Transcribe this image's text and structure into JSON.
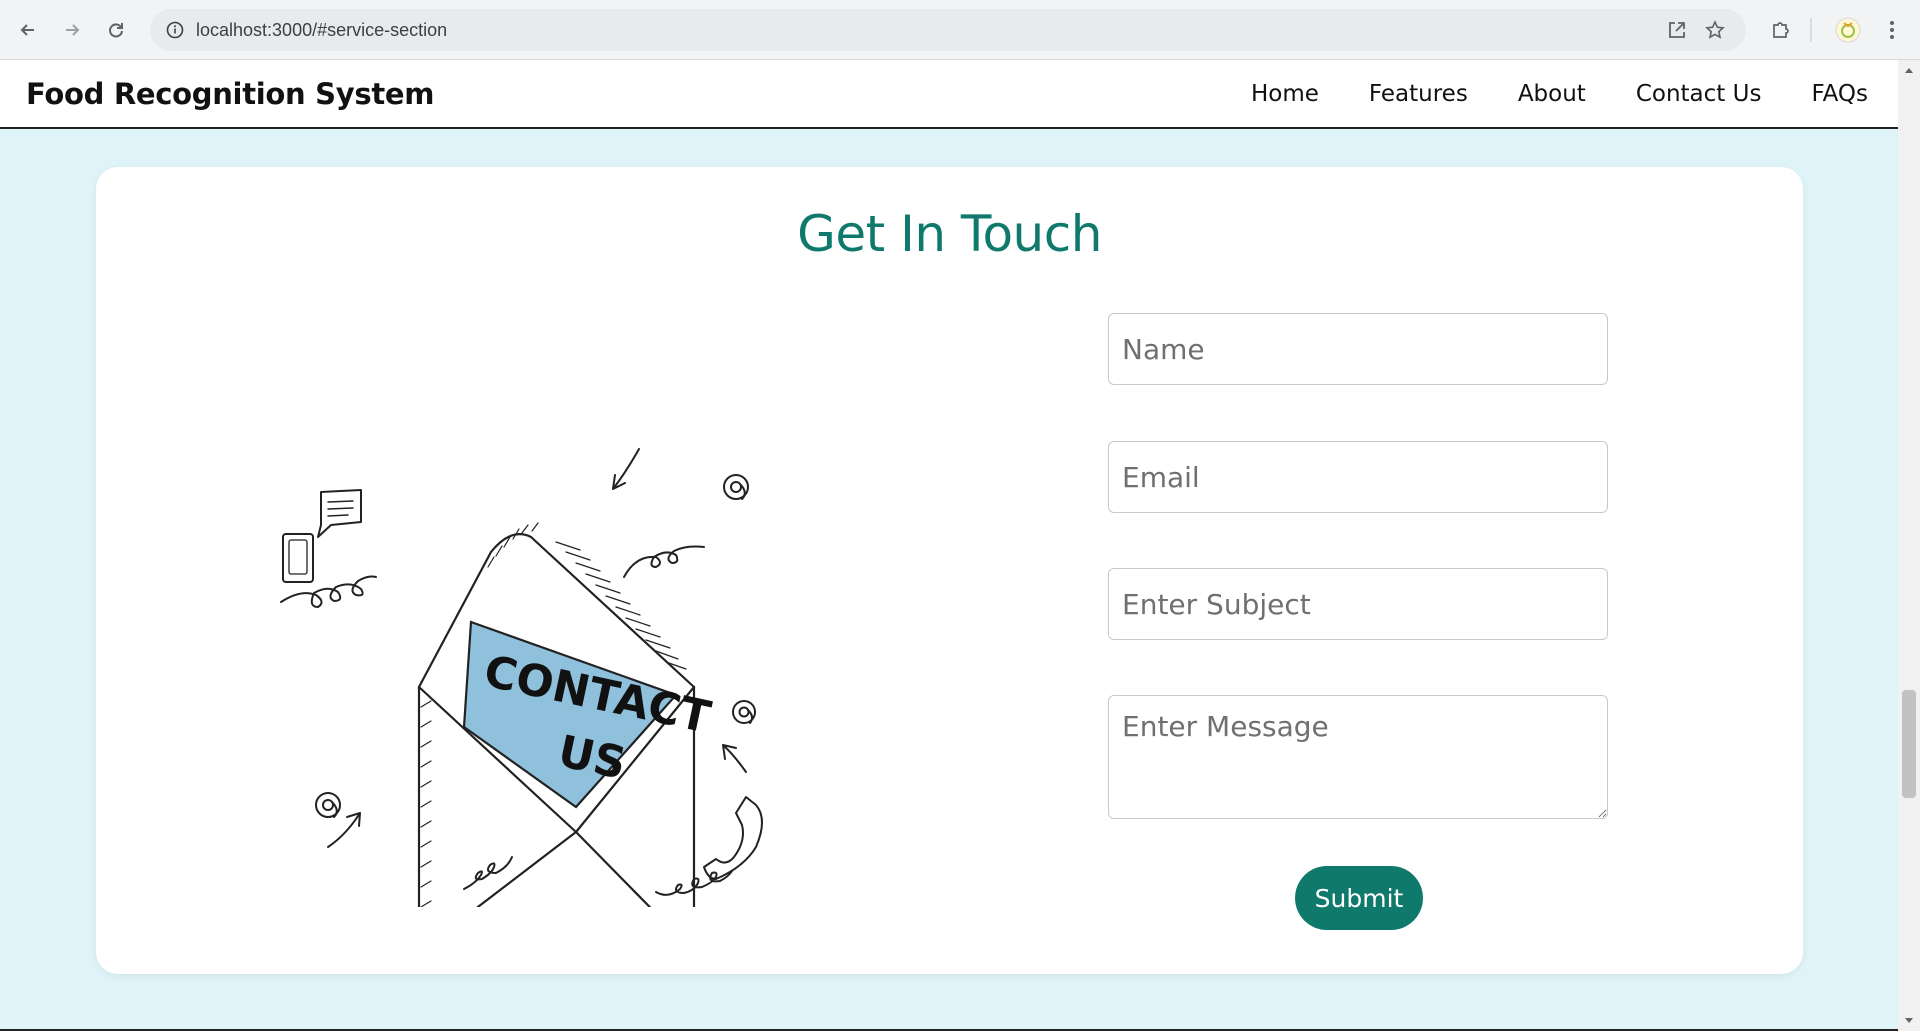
{
  "browser": {
    "url": "localhost:3000/#service-section"
  },
  "header": {
    "brand": "Food Recognition System",
    "nav": [
      "Home",
      "Features",
      "About",
      "Contact Us",
      "FAQs"
    ]
  },
  "contact": {
    "title": "Get In Touch",
    "illustration_text_line1": "CONTACT",
    "illustration_text_line2": "US",
    "fields": {
      "name_placeholder": "Name",
      "email_placeholder": "Email",
      "subject_placeholder": "Enter Subject",
      "message_placeholder": "Enter Message"
    },
    "submit_label": "Submit"
  },
  "colors": {
    "accent": "#0f7a6c",
    "page_bg": "#dff4f8",
    "envelope_letter": "#8fc1dc"
  }
}
